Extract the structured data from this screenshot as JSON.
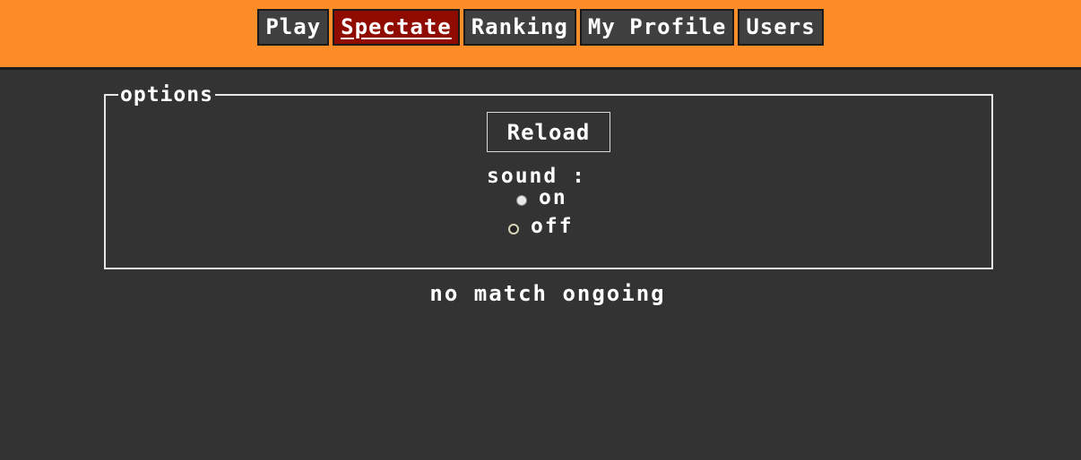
{
  "nav": {
    "items": [
      {
        "label": "Play",
        "active": false
      },
      {
        "label": "Spectate",
        "active": true
      },
      {
        "label": "Ranking",
        "active": false
      },
      {
        "label": "My Profile",
        "active": false
      },
      {
        "label": "Users",
        "active": false
      }
    ]
  },
  "options": {
    "legend": "options",
    "reload_label": "Reload",
    "sound_label": "sound :",
    "sound_options": [
      {
        "label": "on",
        "checked": true
      },
      {
        "label": "off",
        "checked": false
      }
    ]
  },
  "status": {
    "message": "no match ongoing"
  },
  "colors": {
    "topbar": "#fd8d28",
    "background": "#333333",
    "nav_button": "#404040",
    "nav_active": "#8f0b00"
  }
}
